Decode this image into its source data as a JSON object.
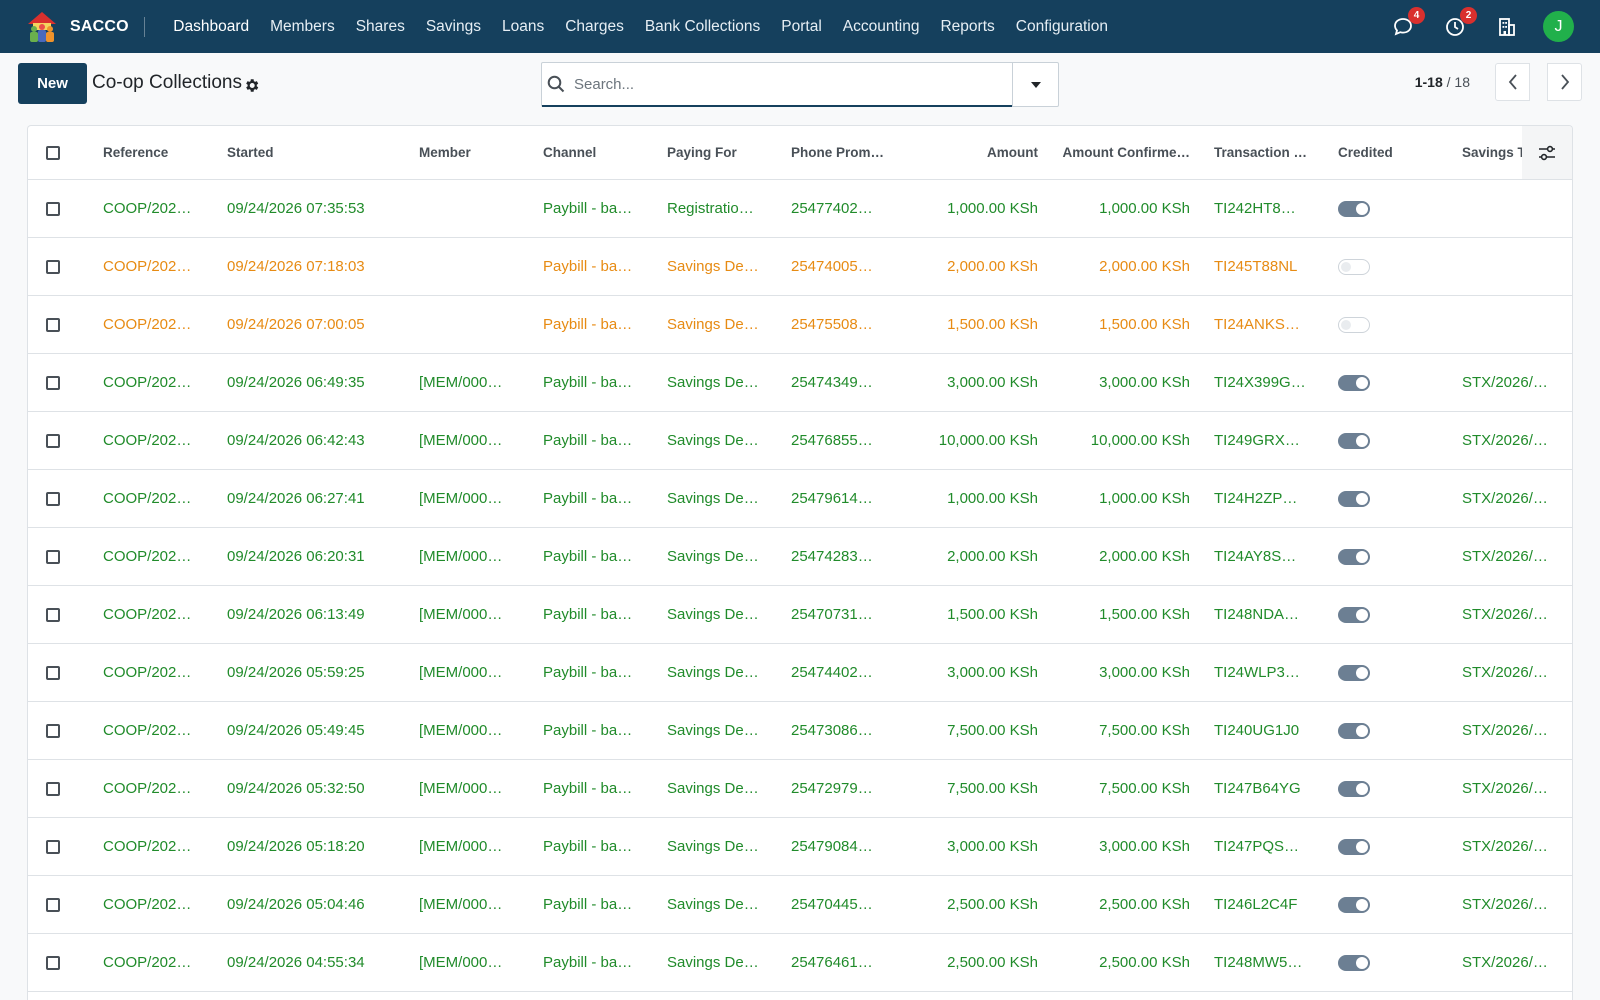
{
  "app": {
    "name": "SACCO"
  },
  "nav": {
    "items": [
      {
        "label": "Dashboard",
        "active": true
      },
      {
        "label": "Members"
      },
      {
        "label": "Shares"
      },
      {
        "label": "Savings"
      },
      {
        "label": "Loans"
      },
      {
        "label": "Charges"
      },
      {
        "label": "Bank Collections"
      },
      {
        "label": "Portal"
      },
      {
        "label": "Accounting"
      },
      {
        "label": "Reports"
      },
      {
        "label": "Configuration"
      }
    ]
  },
  "systray": {
    "messages_count": "4",
    "activities_count": "2",
    "avatar_initial": "J"
  },
  "control": {
    "new_label": "New",
    "title": "Co-op Collections",
    "search_placeholder": "Search...",
    "pager_range": "1-18",
    "pager_total": "/ 18"
  },
  "table": {
    "columns": [
      "Reference",
      "Started",
      "Member",
      "Channel",
      "Paying For",
      "Phone Prom…",
      "Amount",
      "Amount Confirme…",
      "Transaction …",
      "Credited",
      "Savings Tra"
    ],
    "rows": [
      {
        "status": "green",
        "reference": "COOP/202…",
        "started": "09/24/2026 07:35:53",
        "member": "",
        "channel": "Paybill - ba…",
        "paying_for": "Registratio…",
        "phone": "25477402…",
        "amount": "1,000.00 KSh",
        "amount_confirmed": "1,000.00 KSh",
        "transaction": "TI242HT8…",
        "credited": true,
        "savings_tx": ""
      },
      {
        "status": "orange",
        "reference": "COOP/202…",
        "started": "09/24/2026 07:18:03",
        "member": "",
        "channel": "Paybill - ba…",
        "paying_for": "Savings De…",
        "phone": "25474005…",
        "amount": "2,000.00 KSh",
        "amount_confirmed": "2,000.00 KSh",
        "transaction": "TI245T88NL",
        "credited": false,
        "savings_tx": ""
      },
      {
        "status": "orange",
        "reference": "COOP/202…",
        "started": "09/24/2026 07:00:05",
        "member": "",
        "channel": "Paybill - ba…",
        "paying_for": "Savings De…",
        "phone": "25475508…",
        "amount": "1,500.00 KSh",
        "amount_confirmed": "1,500.00 KSh",
        "transaction": "TI24ANKS…",
        "credited": false,
        "savings_tx": ""
      },
      {
        "status": "green",
        "reference": "COOP/202…",
        "started": "09/24/2026 06:49:35",
        "member": "[MEM/000…",
        "channel": "Paybill - ba…",
        "paying_for": "Savings De…",
        "phone": "25474349…",
        "amount": "3,000.00 KSh",
        "amount_confirmed": "3,000.00 KSh",
        "transaction": "TI24X399G…",
        "credited": true,
        "savings_tx": "STX/2026/…"
      },
      {
        "status": "green",
        "reference": "COOP/202…",
        "started": "09/24/2026 06:42:43",
        "member": "[MEM/000…",
        "channel": "Paybill - ba…",
        "paying_for": "Savings De…",
        "phone": "25476855…",
        "amount": "10,000.00 KSh",
        "amount_confirmed": "10,000.00 KSh",
        "transaction": "TI249GRX…",
        "credited": true,
        "savings_tx": "STX/2026/…"
      },
      {
        "status": "green",
        "reference": "COOP/202…",
        "started": "09/24/2026 06:27:41",
        "member": "[MEM/000…",
        "channel": "Paybill - ba…",
        "paying_for": "Savings De…",
        "phone": "25479614…",
        "amount": "1,000.00 KSh",
        "amount_confirmed": "1,000.00 KSh",
        "transaction": "TI24H2ZP…",
        "credited": true,
        "savings_tx": "STX/2026/…"
      },
      {
        "status": "green",
        "reference": "COOP/202…",
        "started": "09/24/2026 06:20:31",
        "member": "[MEM/000…",
        "channel": "Paybill - ba…",
        "paying_for": "Savings De…",
        "phone": "25474283…",
        "amount": "2,000.00 KSh",
        "amount_confirmed": "2,000.00 KSh",
        "transaction": "TI24AY8S…",
        "credited": true,
        "savings_tx": "STX/2026/…"
      },
      {
        "status": "green",
        "reference": "COOP/202…",
        "started": "09/24/2026 06:13:49",
        "member": "[MEM/000…",
        "channel": "Paybill - ba…",
        "paying_for": "Savings De…",
        "phone": "25470731…",
        "amount": "1,500.00 KSh",
        "amount_confirmed": "1,500.00 KSh",
        "transaction": "TI248NDA…",
        "credited": true,
        "savings_tx": "STX/2026/…"
      },
      {
        "status": "green",
        "reference": "COOP/202…",
        "started": "09/24/2026 05:59:25",
        "member": "[MEM/000…",
        "channel": "Paybill - ba…",
        "paying_for": "Savings De…",
        "phone": "25474402…",
        "amount": "3,000.00 KSh",
        "amount_confirmed": "3,000.00 KSh",
        "transaction": "TI24WLP3…",
        "credited": true,
        "savings_tx": "STX/2026/…"
      },
      {
        "status": "green",
        "reference": "COOP/202…",
        "started": "09/24/2026 05:49:45",
        "member": "[MEM/000…",
        "channel": "Paybill - ba…",
        "paying_for": "Savings De…",
        "phone": "25473086…",
        "amount": "7,500.00 KSh",
        "amount_confirmed": "7,500.00 KSh",
        "transaction": "TI240UG1J0",
        "credited": true,
        "savings_tx": "STX/2026/…"
      },
      {
        "status": "green",
        "reference": "COOP/202…",
        "started": "09/24/2026 05:32:50",
        "member": "[MEM/000…",
        "channel": "Paybill - ba…",
        "paying_for": "Savings De…",
        "phone": "25472979…",
        "amount": "7,500.00 KSh",
        "amount_confirmed": "7,500.00 KSh",
        "transaction": "TI247B64YG",
        "credited": true,
        "savings_tx": "STX/2026/…"
      },
      {
        "status": "green",
        "reference": "COOP/202…",
        "started": "09/24/2026 05:18:20",
        "member": "[MEM/000…",
        "channel": "Paybill - ba…",
        "paying_for": "Savings De…",
        "phone": "25479084…",
        "amount": "3,000.00 KSh",
        "amount_confirmed": "3,000.00 KSh",
        "transaction": "TI247PQS…",
        "credited": true,
        "savings_tx": "STX/2026/…"
      },
      {
        "status": "green",
        "reference": "COOP/202…",
        "started": "09/24/2026 05:04:46",
        "member": "[MEM/000…",
        "channel": "Paybill - ba…",
        "paying_for": "Savings De…",
        "phone": "25470445…",
        "amount": "2,500.00 KSh",
        "amount_confirmed": "2,500.00 KSh",
        "transaction": "TI246L2C4F",
        "credited": true,
        "savings_tx": "STX/2026/…"
      },
      {
        "status": "green",
        "reference": "COOP/202…",
        "started": "09/24/2026 04:55:34",
        "member": "[MEM/000…",
        "channel": "Paybill - ba…",
        "paying_for": "Savings De…",
        "phone": "25476461…",
        "amount": "2,500.00 KSh",
        "amount_confirmed": "2,500.00 KSh",
        "transaction": "TI248MW5…",
        "credited": true,
        "savings_tx": "STX/2026/…"
      }
    ]
  },
  "icons": {
    "logo": "sacco-logo-icon",
    "messages": "chat-bubble-icon",
    "activities": "clock-icon",
    "company": "building-icon",
    "gear": "gear-icon",
    "search": "search-icon",
    "dropdown": "caret-down-icon",
    "prev": "chevron-left-icon",
    "next": "chevron-right-icon",
    "optional_columns": "sliders-icon"
  },
  "colors": {
    "navbar": "#15405d",
    "primary_button": "#15405d",
    "row_green": "#208b2a",
    "row_orange": "#e78b13",
    "badge": "#d9302e",
    "avatar": "#21b04b"
  }
}
